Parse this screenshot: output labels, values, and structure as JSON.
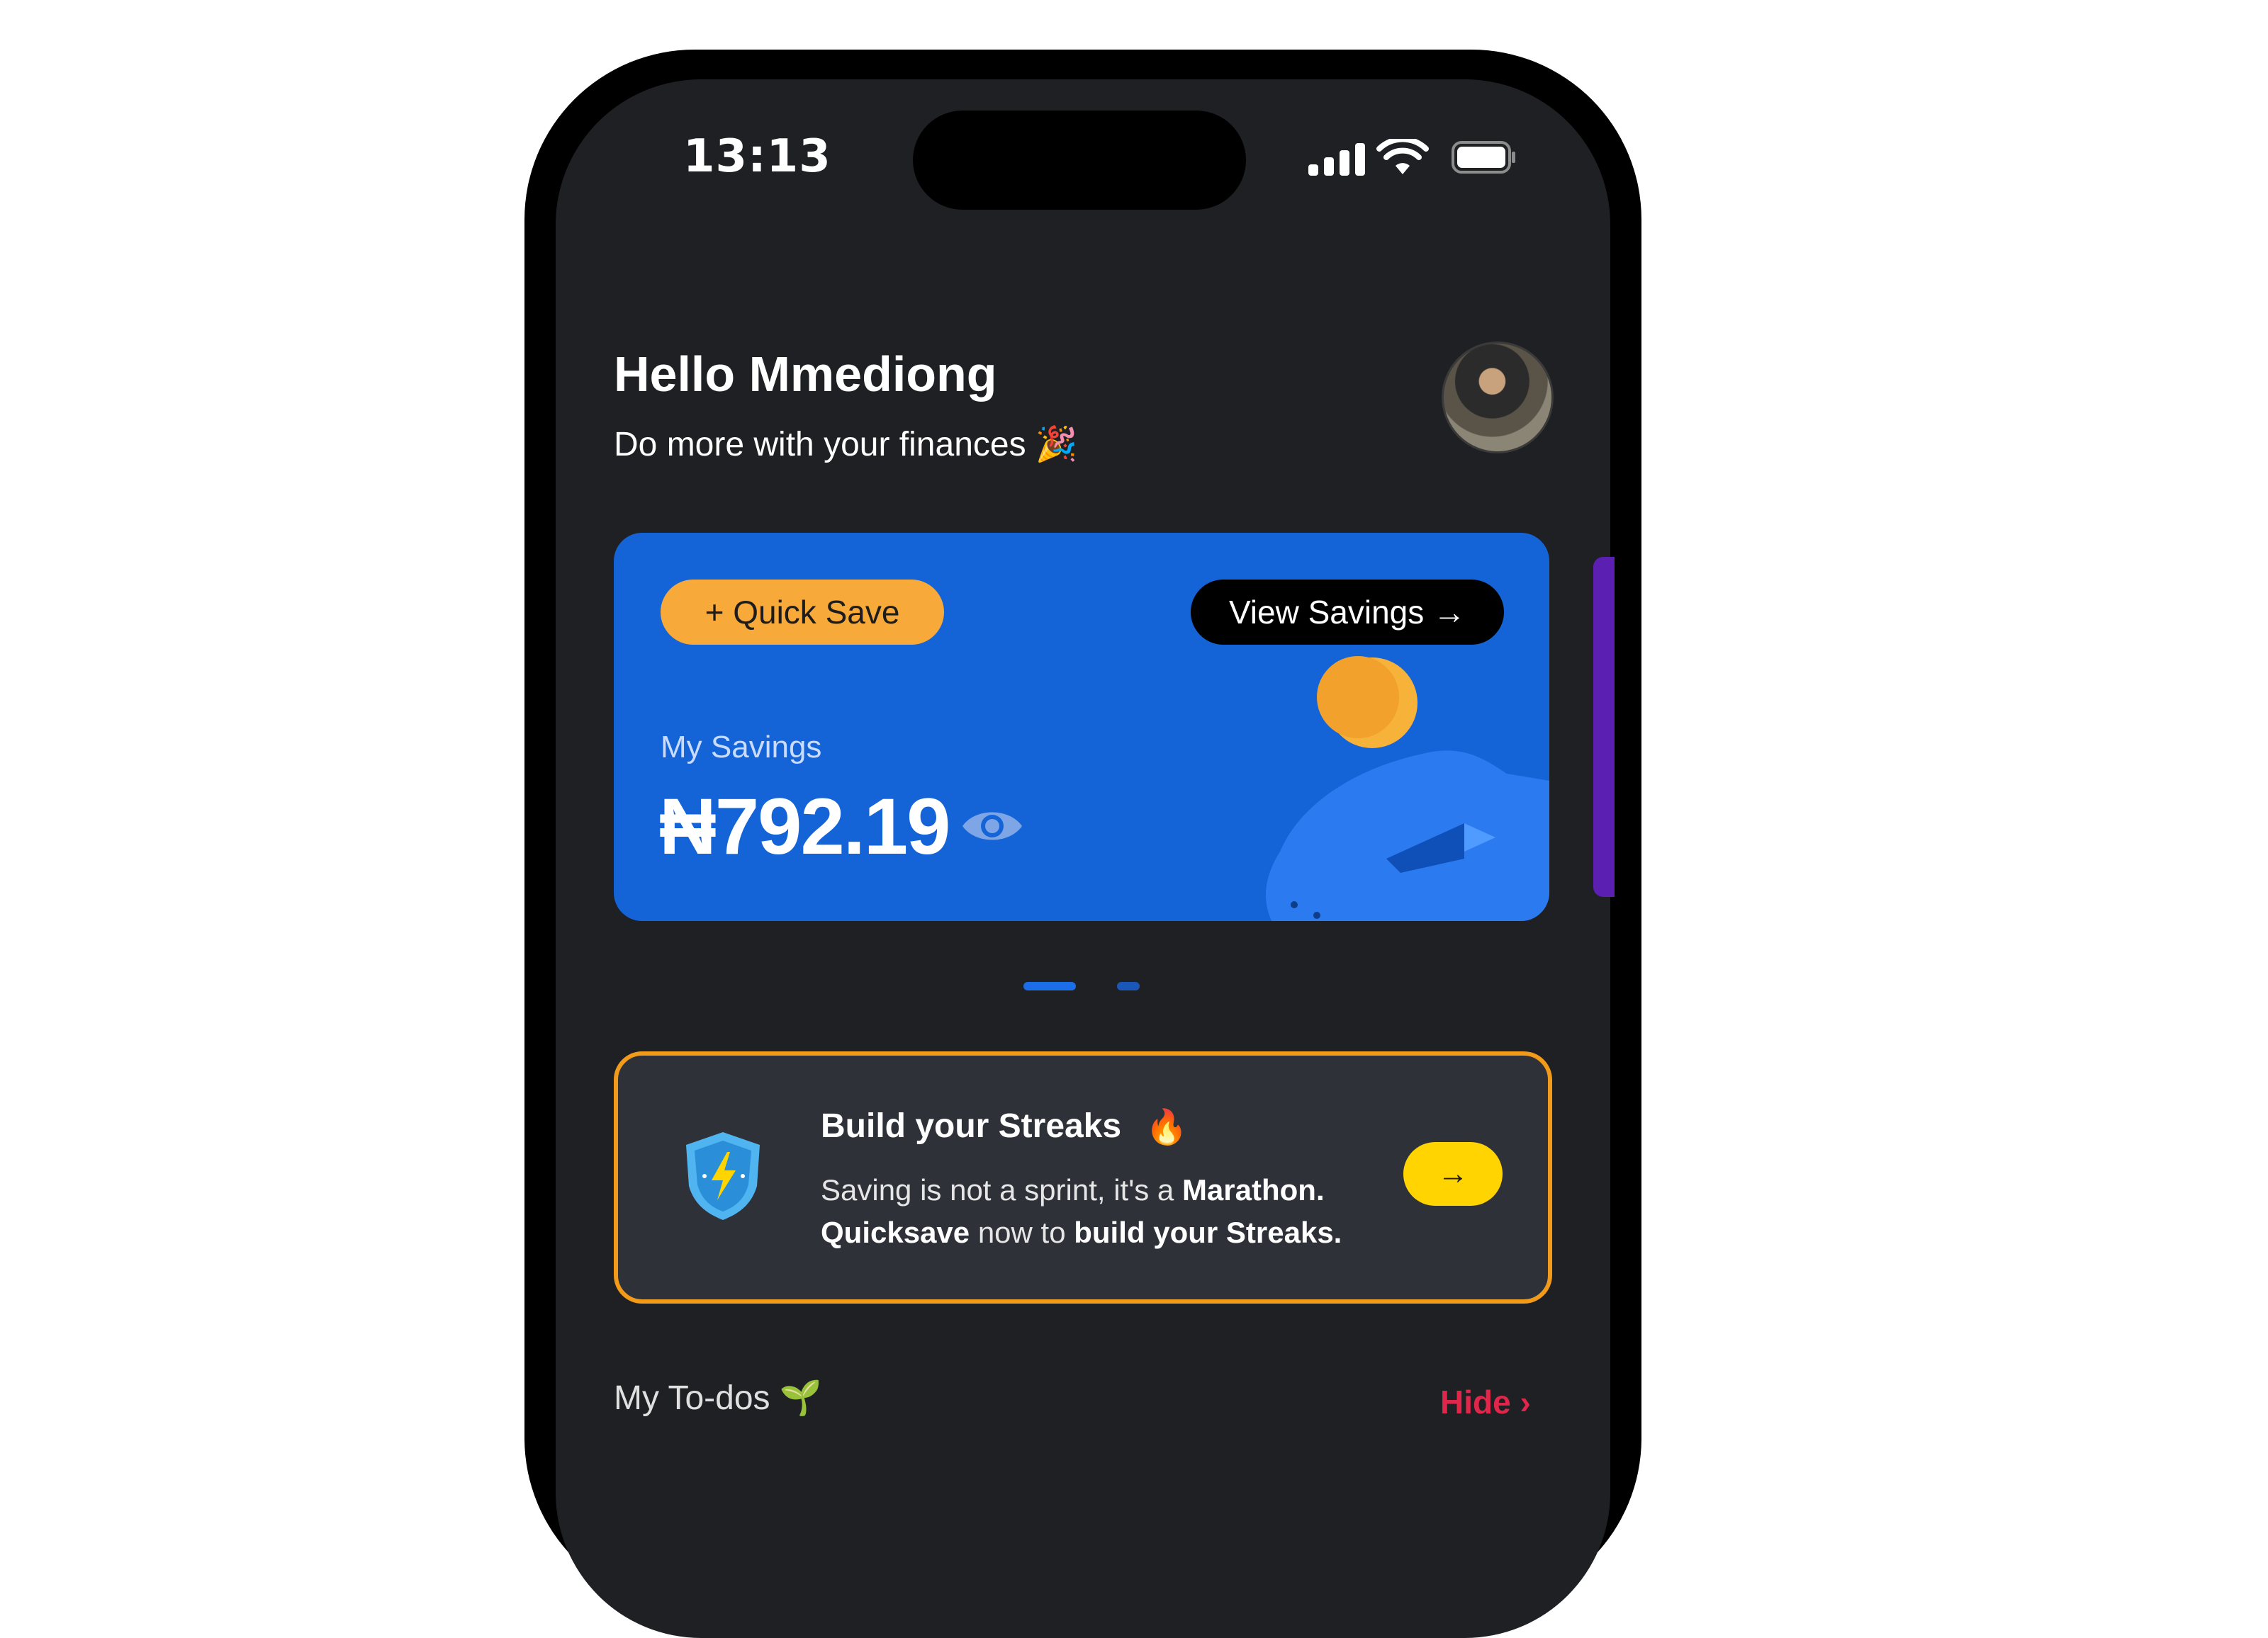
{
  "status_bar": {
    "time": "13:13",
    "signal_icon": "cellular-signal-icon",
    "wifi_icon": "wifi-icon",
    "battery_icon": "battery-icon"
  },
  "header": {
    "greeting": "Hello Mmediong",
    "subtitle": "Do more with your finances 🎉",
    "avatar_icon": "profile-avatar"
  },
  "savings_card": {
    "quick_save_label": "+ Quick Save",
    "view_savings_label": "View Savings →",
    "label": "My Savings",
    "amount": "₦792.19",
    "eye_icon": "eye-icon",
    "background_color": "#1464d8"
  },
  "carousel": {
    "page_count": 2,
    "active_index": 0
  },
  "streak_card": {
    "title": "Build your Streaks",
    "title_emoji": "🔥",
    "body_part1": "Saving is not a sprint, it's a ",
    "body_bold1": "Marathon.",
    "body_bold2": "Quicksave",
    "body_part2": " now to ",
    "body_bold3": "build your Streaks.",
    "arrow_label": "→",
    "border_color": "#f29a1a",
    "button_color": "#ffd400"
  },
  "todos": {
    "title": "My To-dos 🌱",
    "hide_label": "Hide ›"
  }
}
